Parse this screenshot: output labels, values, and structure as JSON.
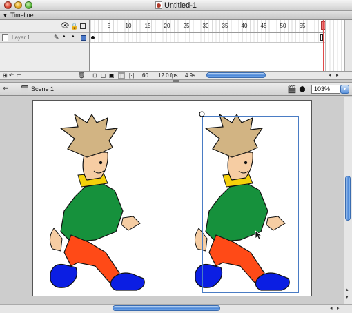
{
  "window": {
    "title": "Untitled-1"
  },
  "timeline": {
    "panel_title": "Timeline",
    "layer_name": "Layer 1",
    "ruler_ticks": [
      "5",
      "10",
      "15",
      "20",
      "25",
      "30",
      "35",
      "40",
      "45",
      "50",
      "55"
    ],
    "current_frame": "60",
    "frame_rate": "12.0 fps",
    "elapsed": "4.9s"
  },
  "editbar": {
    "scene_label": "Scene 1",
    "zoom_value": "103%"
  },
  "colors": {
    "hair": "#d2b483",
    "skin": "#f6cda3",
    "shirt": "#16913c",
    "collar": "#f5d10a",
    "pants": "#ff4a17",
    "shoes": "#0b1ee3",
    "selection": "#4a7cc4",
    "accent": "#4a86d8"
  },
  "icons": {
    "eye": "eye-icon",
    "lock": "lock-icon",
    "outline": "outline-icon",
    "pencil": "pencil-icon",
    "trash": "trash-icon"
  }
}
